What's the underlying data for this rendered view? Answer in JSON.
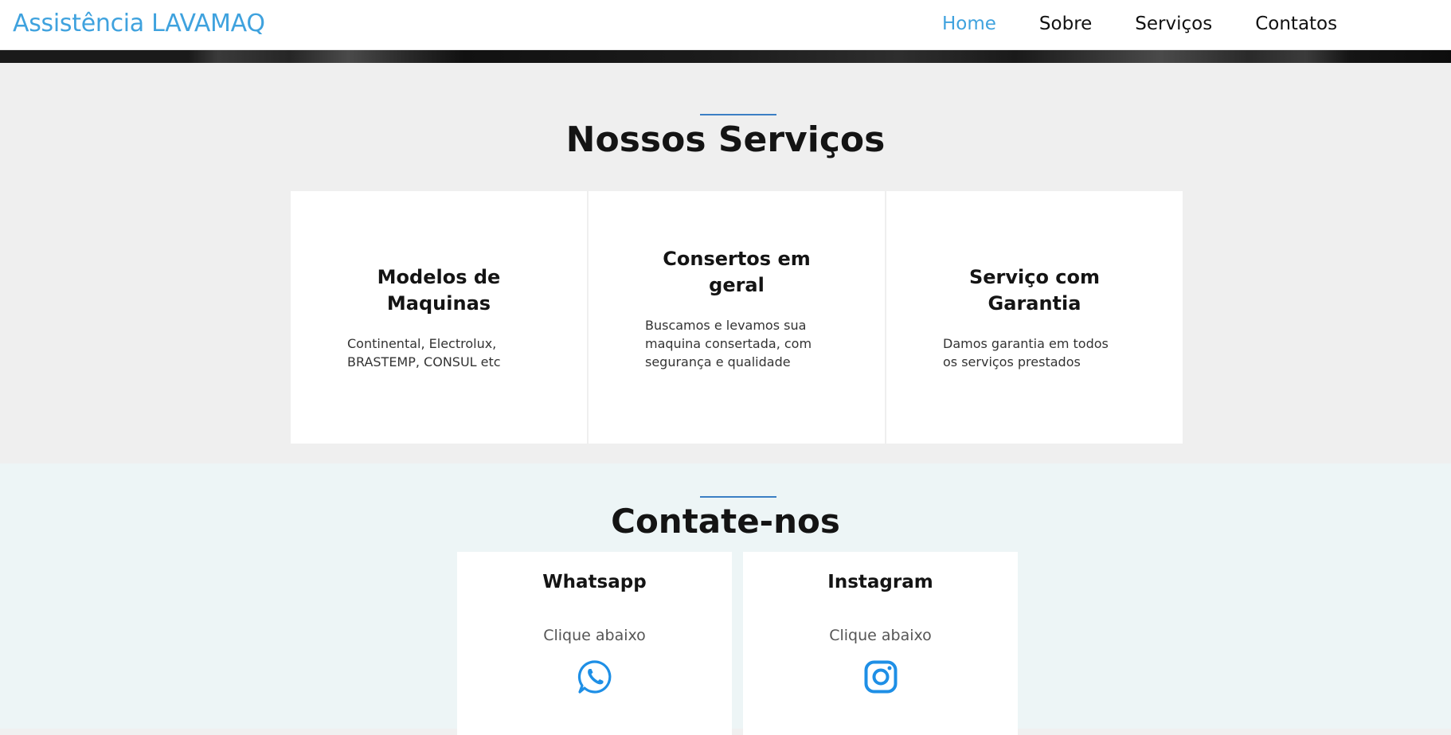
{
  "nav": {
    "brand": "Assistência LAVAMAQ",
    "links": [
      "Home",
      "Sobre",
      "Serviços",
      "Contatos"
    ]
  },
  "services": {
    "title": "Nossos Serviços",
    "cards": [
      {
        "title": "Modelos de Maquinas",
        "text": "Continental, Electrolux, BRASTEMP, CONSUL etc"
      },
      {
        "title": "Consertos em geral",
        "text": "Buscamos e levamos sua maquina consertada, com segurança e qualidade"
      },
      {
        "title": "Serviço com Garantia",
        "text": "Damos garantia em todos os serviços prestados"
      }
    ]
  },
  "contact": {
    "title": "Contate-nos",
    "cards": [
      {
        "title": "Whatsapp",
        "sub": "Clique abaixo",
        "icon": "whatsapp-icon"
      },
      {
        "title": "Instagram",
        "sub": "Clique abaixo",
        "icon": "instagram-icon"
      }
    ]
  },
  "colors": {
    "brand": "#3fa2de",
    "icon": "#1e8fe6",
    "rule": "#3b7fc4"
  }
}
